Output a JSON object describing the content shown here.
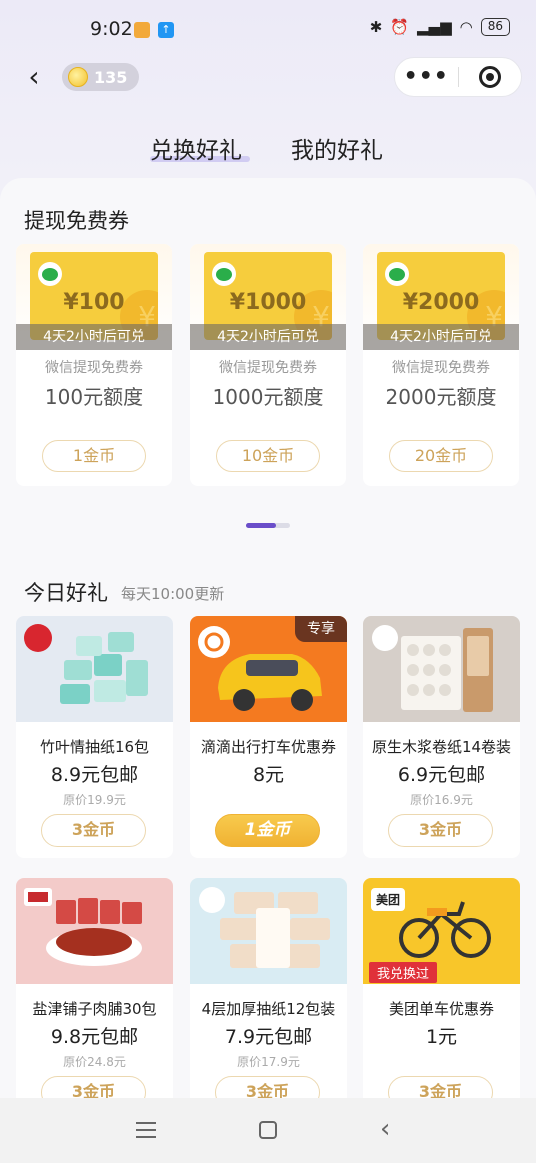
{
  "status_bar": {
    "time": "9:02",
    "battery": "86",
    "icons": [
      "bluetooth-icon",
      "alarm-icon",
      "signal-icon",
      "wifi-icon"
    ]
  },
  "nav": {
    "coins": "135",
    "more_label": "•••"
  },
  "tabs": [
    {
      "label": "兑换好礼",
      "active": true
    },
    {
      "label": "我的好礼",
      "active": false
    }
  ],
  "vouchers": {
    "title": "提现免费券",
    "items": [
      {
        "amount": "¥100",
        "countdown": "4天2小时后可兑",
        "name": "微信提现免费券",
        "quota": "100元额度",
        "price": "1金币"
      },
      {
        "amount": "¥1000",
        "countdown": "4天2小时后可兑",
        "name": "微信提现免费券",
        "quota": "1000元额度",
        "price": "10金币"
      },
      {
        "amount": "¥2000",
        "countdown": "4天2小时后可兑",
        "name": "微信提现免费券",
        "quota": "2000元额度",
        "price": "20金币"
      }
    ]
  },
  "daily": {
    "title": "今日好礼",
    "subtitle": "每天10:00更新",
    "items": [
      {
        "name": "竹叶情抽纸16包",
        "price": "8.9元包邮",
        "original": "原价19.9元",
        "cost": "3金币"
      },
      {
        "name": "滴滴出行打车优惠券",
        "price": "8元",
        "cost": "1金币",
        "tag": "专享"
      },
      {
        "name": "原生木浆卷纸14卷装",
        "price": "6.9元包邮",
        "original": "原价16.9元",
        "cost": "3金币"
      },
      {
        "name": "盐津铺子肉脯30包",
        "price": "9.8元包邮",
        "original": "原价24.8元",
        "cost": "3金币"
      },
      {
        "name": "4层加厚抽纸12包装",
        "price": "7.9元包邮",
        "original": "原价17.9元",
        "cost": "3金币"
      },
      {
        "name": "美团单车优惠券",
        "price": "1元",
        "cost": "3金币",
        "stamp": "我兑换过",
        "brand": "美团"
      }
    ]
  },
  "colors": {
    "accent": "#6a4ec9",
    "gold": "#f0b233",
    "coin_text": "#cda35a"
  }
}
